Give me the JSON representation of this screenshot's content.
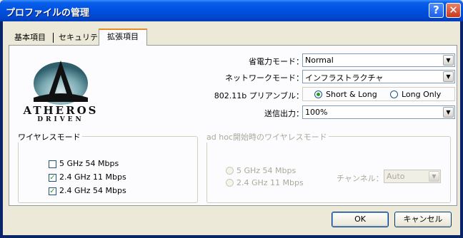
{
  "window": {
    "title": "プロファイルの管理",
    "help_glyph": "?",
    "close_glyph": "✕"
  },
  "tabs": [
    {
      "label": "基本項目"
    },
    {
      "label": "セキュリティ"
    },
    {
      "label": "拡張項目",
      "active": true
    }
  ],
  "logo": {
    "brand": "ATHEROS",
    "tagline": "DRIVEN"
  },
  "settings": {
    "power_mode": {
      "label": "省電力モード：",
      "value": "Normal"
    },
    "network_mode": {
      "label": "ネットワークモード：",
      "value": "インフラストラクチャ"
    },
    "preamble": {
      "label": "802.11b プリアンブル：",
      "options": [
        "Short & Long",
        "Long Only"
      ],
      "selected": "Short & Long"
    },
    "tx_power": {
      "label": "送信出力：",
      "value": "100%"
    }
  },
  "wireless_mode": {
    "title": "ワイヤレスモード",
    "options": [
      {
        "label": "5 GHz 54 Mbps",
        "checked": false
      },
      {
        "label": "2.4 GHz 11 Mbps",
        "checked": true
      },
      {
        "label": "2.4 GHz 54 Mbps",
        "checked": true
      }
    ]
  },
  "adhoc_mode": {
    "title": "ad hoc開始時のワイヤレスモード",
    "options": [
      {
        "label": "5 GHz 54 Mbps"
      },
      {
        "label": "2.4 GHz 11 Mbps"
      }
    ],
    "channel_label": "チャンネル：",
    "channel_value": "Auto"
  },
  "buttons": {
    "ok": "OK",
    "cancel": "キャンセル"
  },
  "colors": {
    "titlebar": "#0054e3",
    "tab_accent": "#e68b2c",
    "check": "#21a121"
  }
}
